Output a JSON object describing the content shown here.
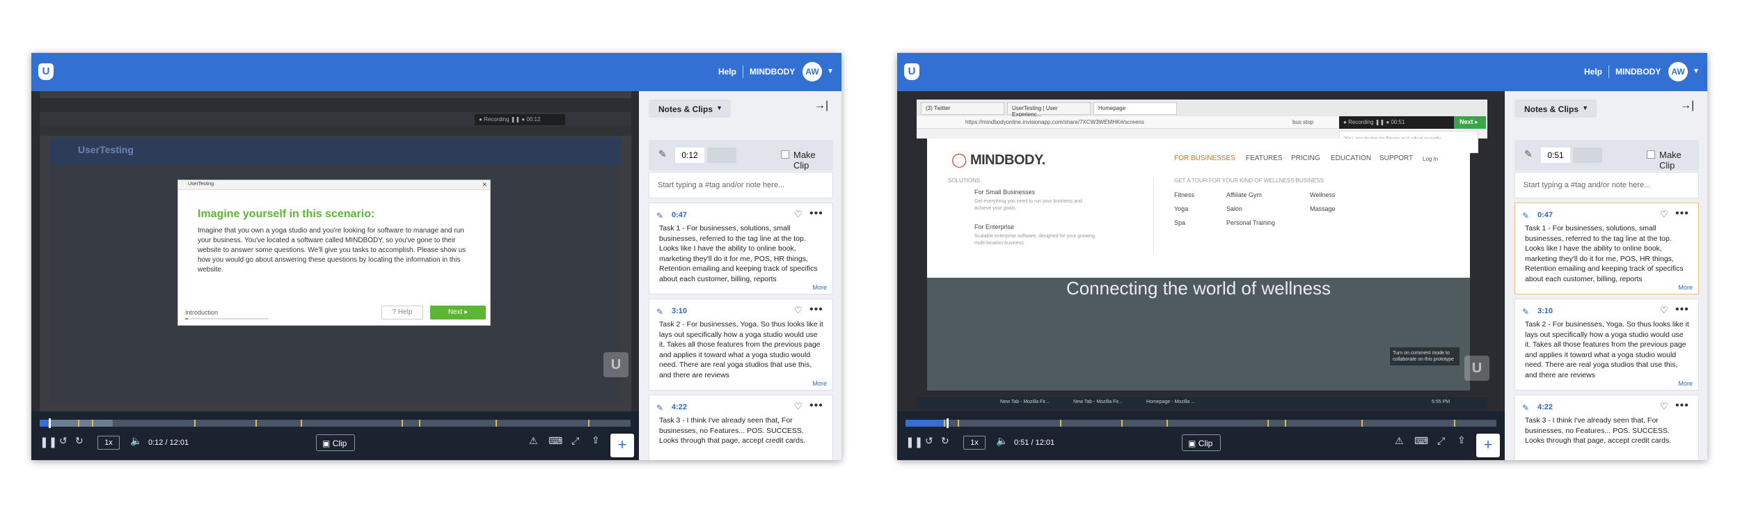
{
  "common": {
    "logo_letter": "U",
    "help": "Help",
    "org": "MINDBODY",
    "avatar": "AW",
    "notes_clips": "Notes & Clips",
    "make_clip": "Make Clip",
    "note_placeholder": "Start typing a #tag and/or note here...",
    "more": "More",
    "speed": "1x",
    "clip": "Clip",
    "duration": "12:01",
    "plus": "+",
    "colors": {
      "accent": "#3370d4",
      "controls": "#1b2230",
      "sidebar": "#eef0f3",
      "marker": "#e5b94a"
    },
    "icons": [
      "pause-icon",
      "rewind-icon",
      "forward-icon",
      "volume-icon",
      "clip-icon",
      "warning-icon",
      "keyboard-icon",
      "fullscreen-icon",
      "share-icon",
      "pen-icon",
      "heart-icon",
      "more-icon",
      "collapse-icon"
    ]
  },
  "panel1": {
    "current_time": "0:12",
    "clip_time": "0:12",
    "progress": 0.017,
    "notes": [
      {
        "time": "0:47",
        "text": "Task 1 - For businesses, solutions, small businesses, referred to the tag line at the top. Looks like I have the ability to online book, marketing they'll do it for me, POS, HR things, Retention emailing and keeping track of specifics about each customer, billing, reports"
      },
      {
        "time": "3:10",
        "text": "Task 2 - For businesses, Yoga. So thus looks like it lays out specifically how a yoga studio would use it. Takes all those features from the previous page and applies it toward what a yoga studio would need. There are real yoga studios that use this, and there are reviews"
      },
      {
        "time": "4:22",
        "text": "Task 3 - I think I've already seen that, For businesses, no Features... POS. SUCCESS. Looks through that page, accept credit cards."
      }
    ],
    "video": {
      "tab_title": "UserTesting",
      "dialog_title": "Imagine yourself in this scenario:",
      "dialog_body": "Imagine that you own a yoga studio and you're looking for software to manage and run your business. You've located a software called MINDBODY, so you've gone to their website to answer some questions. We'll give you tasks to accomplish. Please show us how you would go about answering these questions by locating the information in this website.",
      "intro": "Introduction",
      "help_btn": "Help",
      "next_btn": "Next",
      "recording": "Recording",
      "rec_time": "00:12",
      "site_logo": "UserTesting"
    }
  },
  "panel2": {
    "current_time": "0:51",
    "clip_time": "0:51",
    "progress": 0.071,
    "notes": [
      {
        "time": "0:47",
        "text": "Task 1 - For businesses, solutions, small businesses, referred to the tag line at the top. Looks like I have the ability to online book, marketing they'll do it for me, POS, HR things, Retention emailing and keeping track of specifics about each customer, billing, reports"
      },
      {
        "time": "3:10",
        "text": "Task 2 - For businesses, Yoga. So thus looks like it lays out specifically how a yoga studio would use it. Takes all those features from the previous page and applies it toward what a yoga studio would need. There are real yoga studios that use this, and there are reviews"
      },
      {
        "time": "4:22",
        "text": "Task 3 - I think I've already seen that, For businesses, no Features... POS. SUCCESS. Looks through that page, accept credit cards."
      }
    ],
    "video": {
      "tabs": [
        "(3) Twitter",
        "UserTesting | User Experienc...",
        "Homepage"
      ],
      "url": "https://mindbodyonline.invisionapp.com/share/7XCW3WEMHK#/screens",
      "search": "bus stop",
      "recording": "Recording",
      "rec_time": "00:51",
      "next_btn": "Next",
      "prompt": "You are trying to figure out what exactly",
      "logo_main": "MINDBODY.",
      "nav": [
        "FOR BUSINESSES",
        "FEATURES",
        "PRICING",
        "EDUCATION",
        "SUPPORT",
        "Log In"
      ],
      "solutions": "SOLUTIONS",
      "small_biz": "For Small Businesses",
      "small_biz_sub": "Get everything you need to run your business and achieve your goals.",
      "enterprise": "For Enterprise",
      "enterprise_sub": "Scalable enterprise software, designed for your growing, multi-location business.",
      "tour": "GET A TOUR FOR YOUR KIND OF WELLNESS BUSINESS",
      "kinds": [
        "Fitness",
        "Affiliate Gym",
        "Wellness",
        "Yoga",
        "Salon",
        "Massage",
        "Spa",
        "Personal Training"
      ],
      "hero": "Connecting the world of wellness",
      "comment_tip": "Turn on comment mode to collaborate on this prototype",
      "taskbar": [
        "New Tab - Mozilla Fir...",
        "New Tab - Mozilla Fir...",
        "Homepage - Mozilla ...",
        "6:55 PM"
      ]
    }
  }
}
